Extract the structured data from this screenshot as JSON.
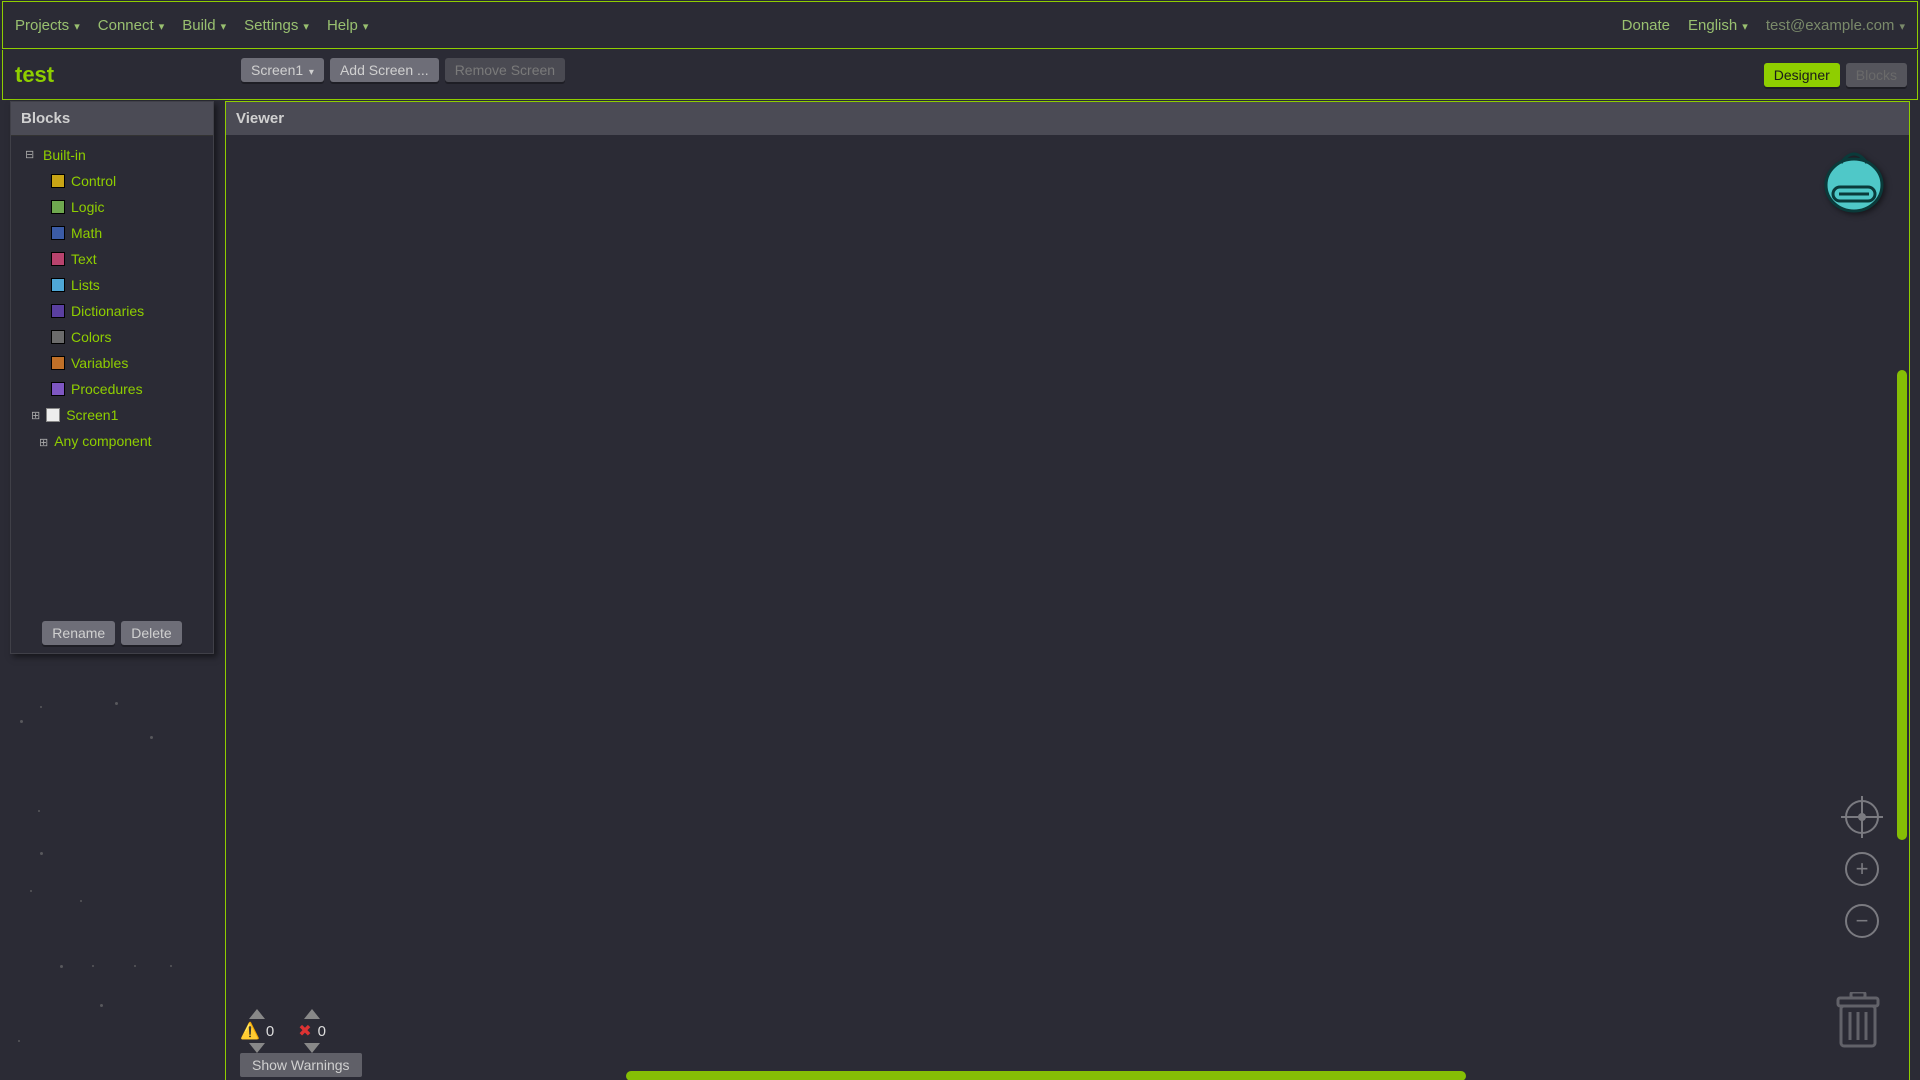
{
  "menubar": {
    "left": [
      "Projects",
      "Connect",
      "Build",
      "Settings",
      "Help"
    ],
    "donate": "Donate",
    "language": "English",
    "account": "test@example.com"
  },
  "project_title": "test",
  "screenbar": {
    "current_screen": "Screen1",
    "add_screen": "Add Screen ...",
    "remove_screen": "Remove Screen"
  },
  "view_toggle": {
    "designer": "Designer",
    "blocks": "Blocks"
  },
  "blocks_panel": {
    "title": "Blocks",
    "builtin_label": "Built-in",
    "categories": [
      {
        "name": "Control",
        "color": "#c8a415"
      },
      {
        "name": "Logic",
        "color": "#6fa84f"
      },
      {
        "name": "Math",
        "color": "#3b5ba5"
      },
      {
        "name": "Text",
        "color": "#b8436d"
      },
      {
        "name": "Lists",
        "color": "#4fa7d6"
      },
      {
        "name": "Dictionaries",
        "color": "#5a3fa0"
      },
      {
        "name": "Colors",
        "color": "#6b6b6b"
      },
      {
        "name": "Variables",
        "color": "#c07028"
      },
      {
        "name": "Procedures",
        "color": "#7e57c2"
      }
    ],
    "screen_label": "Screen1",
    "any_component": "Any component",
    "rename": "Rename",
    "delete": "Delete"
  },
  "viewer": {
    "title": "Viewer",
    "warnings_count": "0",
    "errors_count": "0",
    "show_warnings": "Show Warnings"
  },
  "stars": [
    {
      "l": 20,
      "t": 720,
      "s": 3
    },
    {
      "l": 40,
      "t": 706,
      "s": 2
    },
    {
      "l": 115,
      "t": 702,
      "s": 3
    },
    {
      "l": 150,
      "t": 736,
      "s": 3
    },
    {
      "l": 38,
      "t": 810,
      "s": 2
    },
    {
      "l": 40,
      "t": 852,
      "s": 3
    },
    {
      "l": 30,
      "t": 890,
      "s": 2
    },
    {
      "l": 80,
      "t": 900,
      "s": 2
    },
    {
      "l": 100,
      "t": 1004,
      "s": 3
    },
    {
      "l": 60,
      "t": 965,
      "s": 3
    },
    {
      "l": 92,
      "t": 965,
      "s": 2
    },
    {
      "l": 134,
      "t": 965,
      "s": 2
    },
    {
      "l": 170,
      "t": 965,
      "s": 2
    },
    {
      "l": 18,
      "t": 1040,
      "s": 2
    }
  ]
}
